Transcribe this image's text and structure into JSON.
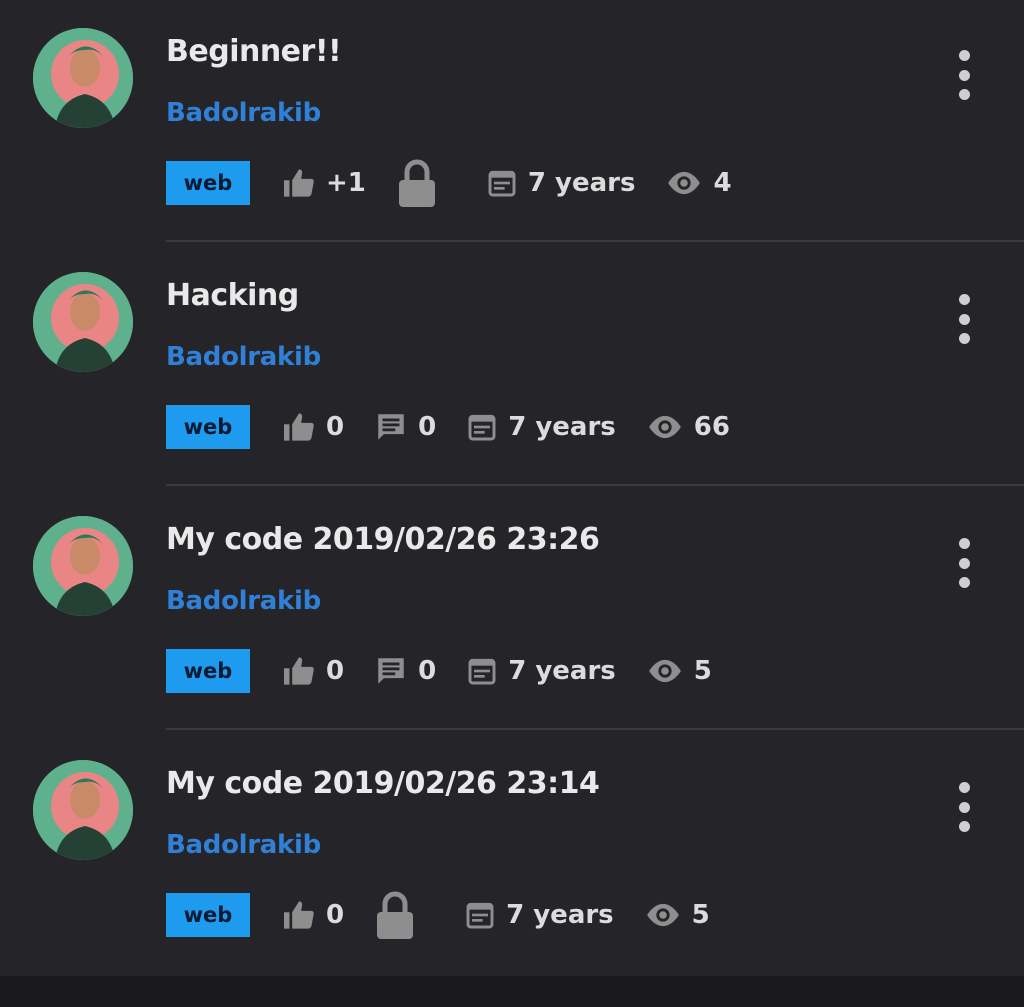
{
  "posts": [
    {
      "title": "Beginner!!",
      "author": "Badolrakib",
      "tag": "web",
      "likes": "+1",
      "locked": true,
      "comments": null,
      "age": "7 years",
      "views": "4"
    },
    {
      "title": "Hacking",
      "author": "Badolrakib",
      "tag": "web",
      "likes": "0",
      "locked": false,
      "comments": "0",
      "age": "7 years",
      "views": "66"
    },
    {
      "title": "My code 2019/02/26 23:26",
      "author": "Badolrakib",
      "tag": "web",
      "likes": "0",
      "locked": false,
      "comments": "0",
      "age": "7 years",
      "views": "5"
    },
    {
      "title": "My code 2019/02/26 23:14",
      "author": "Badolrakib",
      "tag": "web",
      "likes": "0",
      "locked": true,
      "comments": null,
      "age": "7 years",
      "views": "5"
    }
  ],
  "icons": {
    "like": "thumbs-up-icon",
    "comment": "comment-icon",
    "lock": "lock-icon",
    "date": "calendar-icon",
    "views": "eye-icon",
    "menu": "more-vertical-icon"
  },
  "colors": {
    "background": "#252529",
    "accent": "#1e9bef",
    "author": "#2f80d6"
  }
}
